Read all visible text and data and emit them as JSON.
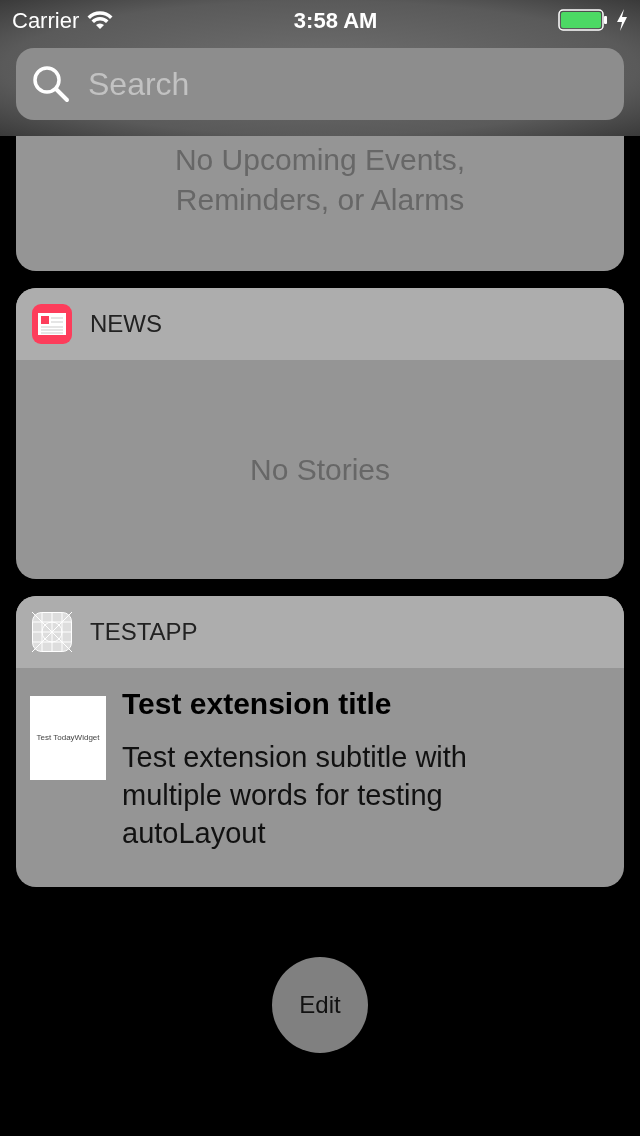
{
  "status_bar": {
    "carrier": "Carrier",
    "time": "3:58 AM",
    "charging": true
  },
  "search": {
    "placeholder": "Search"
  },
  "widgets": [
    {
      "kind": "empty",
      "message_lines": [
        "No Upcoming Events,",
        "Reminders, or Alarms"
      ]
    },
    {
      "kind": "empty",
      "app": {
        "name": "NEWS"
      },
      "message_lines": [
        "No Stories"
      ]
    },
    {
      "kind": "item",
      "app": {
        "name": "TESTAPP"
      },
      "thumbnail": "Test TodayWidget",
      "title": "Test extension title",
      "subtitle": "Test extension subtitle with multiple words for testing autoLayout"
    }
  ],
  "edit_button": "Edit"
}
